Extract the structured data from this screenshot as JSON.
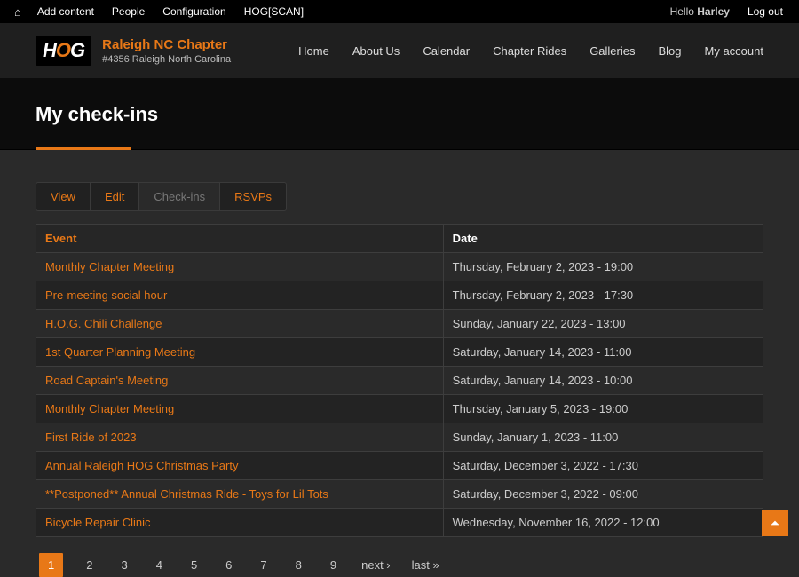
{
  "admin": {
    "items": [
      "Add content",
      "People",
      "Configuration",
      "HOG[SCAN]"
    ],
    "hello_prefix": "Hello ",
    "hello_user": "Harley",
    "logout": "Log out"
  },
  "brand": {
    "title": "Raleigh NC Chapter",
    "subtitle": "#4356 Raleigh North Carolina"
  },
  "nav": [
    "Home",
    "About Us",
    "Calendar",
    "Chapter Rides",
    "Galleries",
    "Blog",
    "My account"
  ],
  "page_title": "My check-ins",
  "tabs": [
    {
      "label": "View",
      "active": false
    },
    {
      "label": "Edit",
      "active": false
    },
    {
      "label": "Check-ins",
      "active": true
    },
    {
      "label": "RSVPs",
      "active": false
    }
  ],
  "table": {
    "headers": {
      "event": "Event",
      "date": "Date"
    },
    "rows": [
      {
        "event": "Monthly Chapter Meeting",
        "date": "Thursday, February 2, 2023 - 19:00"
      },
      {
        "event": "Pre-meeting social hour",
        "date": "Thursday, February 2, 2023 - 17:30"
      },
      {
        "event": "H.O.G. Chili Challenge",
        "date": "Sunday, January 22, 2023 - 13:00"
      },
      {
        "event": "1st Quarter Planning Meeting",
        "date": "Saturday, January 14, 2023 - 11:00"
      },
      {
        "event": "Road Captain's Meeting",
        "date": "Saturday, January 14, 2023 - 10:00"
      },
      {
        "event": "Monthly Chapter Meeting",
        "date": "Thursday, January 5, 2023 - 19:00"
      },
      {
        "event": "First Ride of 2023",
        "date": "Sunday, January 1, 2023 - 11:00"
      },
      {
        "event": "Annual Raleigh HOG Christmas Party",
        "date": "Saturday, December 3, 2022 - 17:30"
      },
      {
        "event": "**Postponed** Annual Christmas Ride - Toys for Lil Tots",
        "date": "Saturday, December 3, 2022 - 09:00"
      },
      {
        "event": "Bicycle Repair Clinic",
        "date": "Wednesday, November 16, 2022 - 12:00"
      }
    ]
  },
  "pager": {
    "pages": [
      "1",
      "2",
      "3",
      "4",
      "5",
      "6",
      "7",
      "8",
      "9"
    ],
    "active": "1",
    "next": "next ›",
    "last": "last »"
  }
}
